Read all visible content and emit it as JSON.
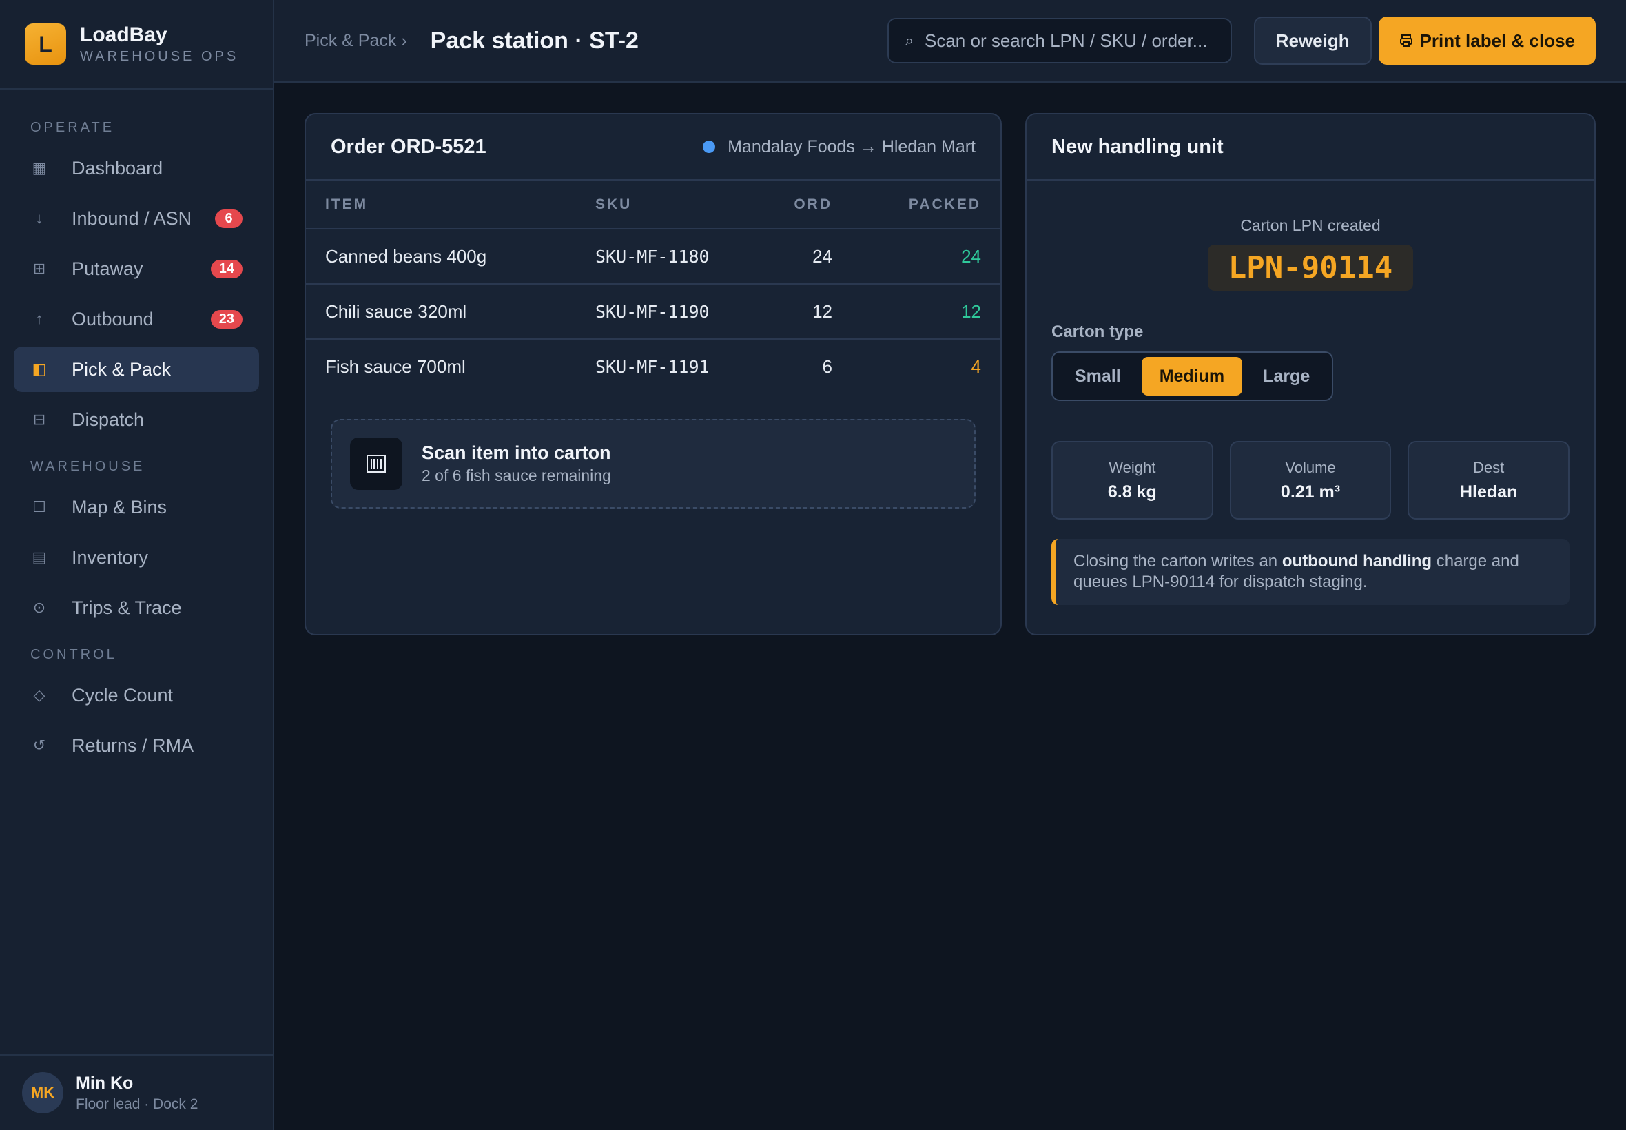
{
  "brand": {
    "name": "LoadBay",
    "subtitle": "WAREHOUSE OPS",
    "logo_letter": "L"
  },
  "sidebar": {
    "sections": [
      {
        "title": "OPERATE"
      },
      {
        "title": "WAREHOUSE"
      },
      {
        "title": "CONTROL"
      }
    ],
    "items": [
      {
        "label": "Dashboard",
        "icon": "dashboard-icon",
        "glyph": "▦"
      },
      {
        "label": "Inbound / ASN",
        "icon": "arrow-down-icon",
        "glyph": "↓",
        "badge": "6"
      },
      {
        "label": "Putaway",
        "icon": "grid-icon",
        "glyph": "⊞",
        "badge": "14"
      },
      {
        "label": "Outbound",
        "icon": "arrow-up-icon",
        "glyph": "↑",
        "badge": "23"
      },
      {
        "label": "Pick & Pack",
        "icon": "pack-icon",
        "glyph": "◧",
        "active": true
      },
      {
        "label": "Dispatch",
        "icon": "dispatch-icon",
        "glyph": "⊟"
      },
      {
        "label": "Map & Bins",
        "icon": "map-icon",
        "glyph": "☐"
      },
      {
        "label": "Inventory",
        "icon": "inventory-icon",
        "glyph": "▤"
      },
      {
        "label": "Trips & Trace",
        "icon": "trace-icon",
        "glyph": "⊙"
      },
      {
        "label": "Cycle Count",
        "icon": "diamond-icon",
        "glyph": "◇"
      },
      {
        "label": "Returns / RMA",
        "icon": "return-icon",
        "glyph": "↺"
      }
    ]
  },
  "user": {
    "initials": "MK",
    "name": "Min Ko",
    "role": "Floor lead · Dock 2"
  },
  "topbar": {
    "breadcrumb": "Pick & Pack ›",
    "title": "Pack station · ST-2",
    "search_placeholder": "Scan or search LPN / SKU / order...",
    "reweigh_label": "Reweigh",
    "print_label": "Print label & close",
    "print_icon": "printer-icon"
  },
  "order": {
    "title": "Order ORD-5521",
    "route": "Mandalay Foods → Hledan Mart",
    "columns": [
      "ITEM",
      "SKU",
      "ORD",
      "PACKED"
    ],
    "rows": [
      {
        "item": "Canned beans 400g",
        "sku": "SKU-MF-1180",
        "ord": "24",
        "packed": "24",
        "status": "complete"
      },
      {
        "item": "Chili sauce 320ml",
        "sku": "SKU-MF-1190",
        "ord": "12",
        "packed": "12",
        "status": "complete"
      },
      {
        "item": "Fish sauce 700ml",
        "sku": "SKU-MF-1191",
        "ord": "6",
        "packed": "4",
        "status": "partial"
      }
    ],
    "scan": {
      "title": "Scan item into carton",
      "subtitle": "2 of 6 fish sauce remaining",
      "icon": "barcode-icon"
    }
  },
  "handling_unit": {
    "title": "New handling unit",
    "lpn_caption": "Carton LPN created",
    "lpn": "LPN-90114",
    "carton_label": "Carton type",
    "carton_options": [
      "Small",
      "Medium",
      "Large"
    ],
    "carton_selected": "Medium",
    "stats": [
      {
        "label": "Weight",
        "value": "6.8 kg"
      },
      {
        "label": "Volume",
        "value": "0.21 m³"
      },
      {
        "label": "Dest",
        "value": "Hledan"
      }
    ],
    "note_pre": "Closing the carton writes an ",
    "note_bold": "outbound handling",
    "note_post": " charge and queues LPN-90114 for dispatch staging."
  },
  "colors": {
    "accent": "#f5a623",
    "complete": "#2fc89a",
    "badge": "#e5484d",
    "route_dot": "#4a9af5"
  }
}
